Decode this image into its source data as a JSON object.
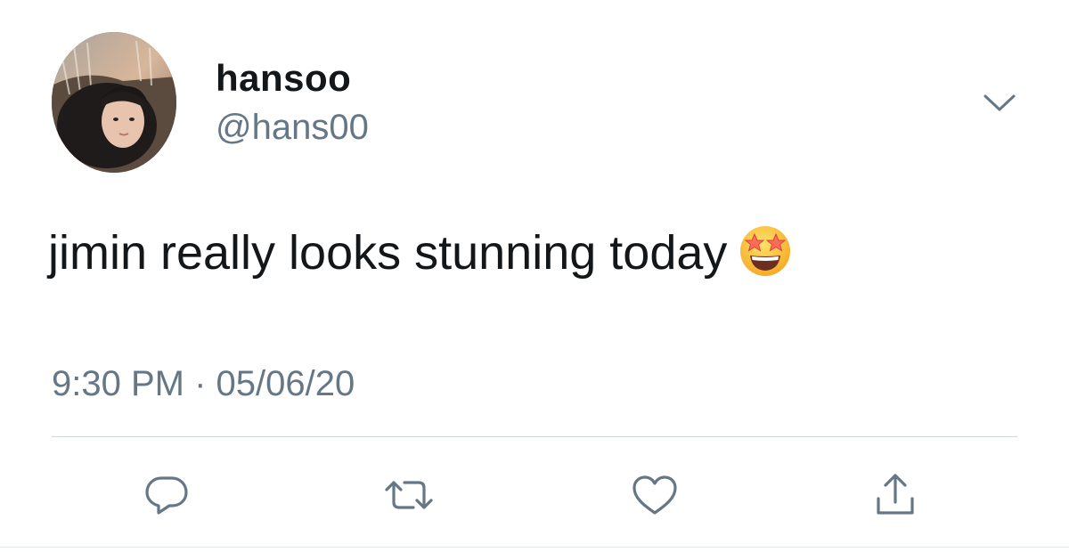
{
  "user": {
    "display_name": "hansoo",
    "handle": "@hans00"
  },
  "tweet": {
    "text": "jimin really looks stunning today",
    "emoji": "star-struck",
    "time": "9:30 PM",
    "separator": "·",
    "date": "05/06/20"
  },
  "actions": {
    "reply": "reply-icon",
    "retweet": "retweet-icon",
    "like": "heart-icon",
    "share": "share-icon"
  },
  "colors": {
    "primary_text": "#14171a",
    "secondary_text": "#657786",
    "icon": "#657786",
    "divider": "#ccd6dd"
  }
}
